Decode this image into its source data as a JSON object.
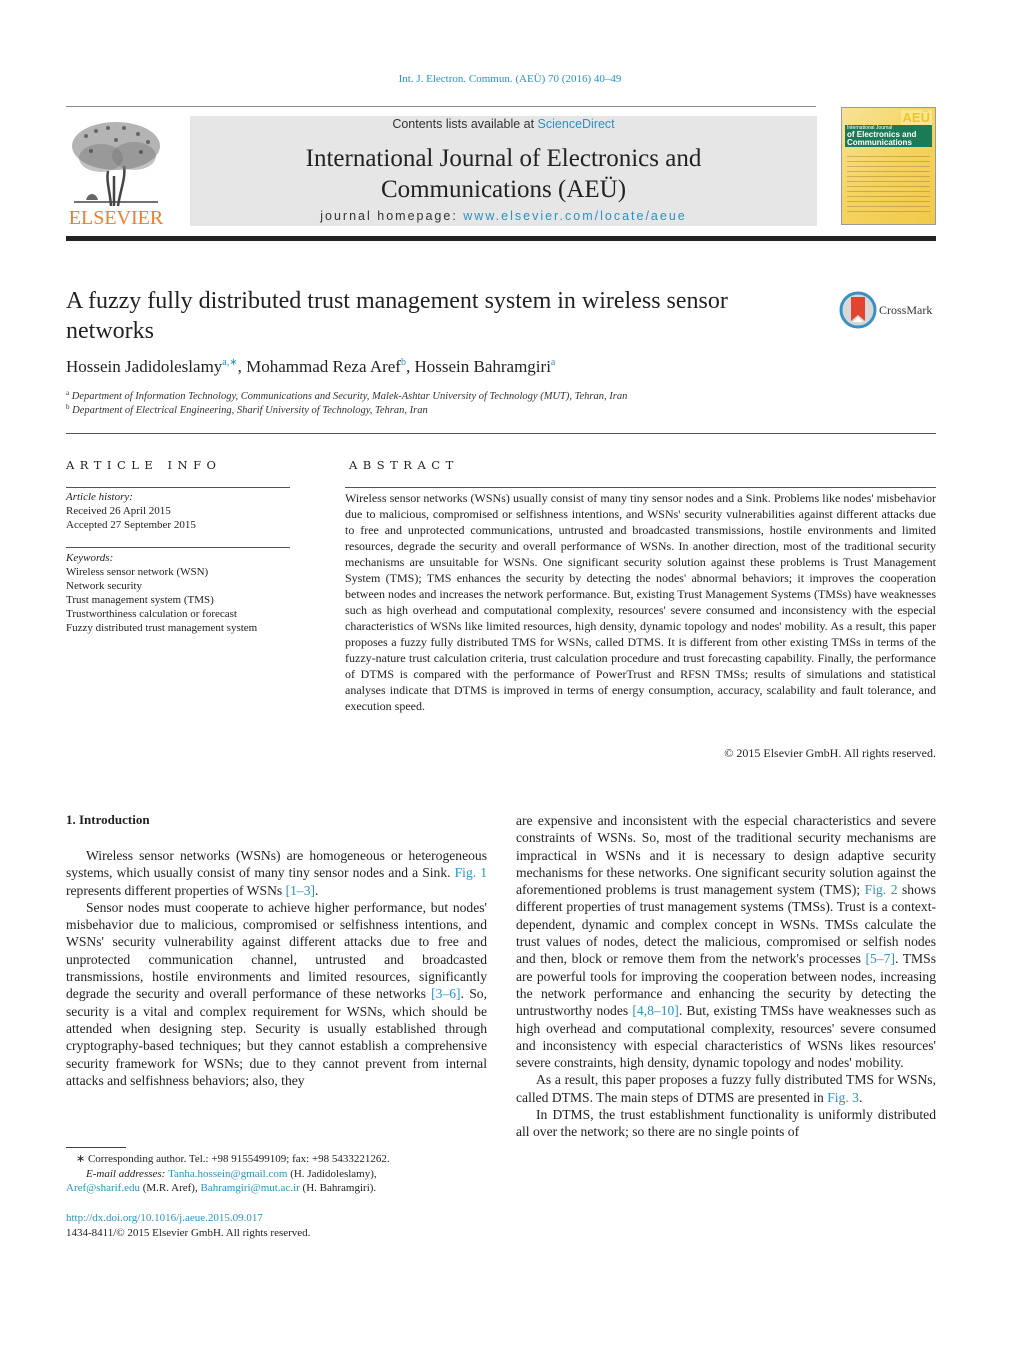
{
  "header": {
    "citation": "Int. J. Electron. Commun. (AEÜ) 70 (2016) 40–49",
    "publisher_logo_text": "ELSEVIER",
    "contents_prefix": "Contents lists available at ",
    "contents_link": "ScienceDirect",
    "journal_title_line1": "International Journal of Electronics and",
    "journal_title_line2": "Communications (AEÜ)",
    "homepage_prefix": "journal homepage: ",
    "homepage_link": "www.elsevier.com/locate/aeue",
    "cover": {
      "badge": "AEÜ",
      "line1": "International Journal",
      "line2": "of Electronics and",
      "line3": "Communications"
    }
  },
  "article": {
    "title": "A fuzzy fully distributed trust management system in wireless sensor networks",
    "crossmark_label": "CrossMark",
    "authors": [
      {
        "name": "Hossein Jadidoleslamy",
        "sup": "a,∗"
      },
      {
        "name": "Mohammad Reza Aref",
        "sup": "b"
      },
      {
        "name": "Hossein Bahramgiri",
        "sup": "a"
      }
    ],
    "affiliations": [
      {
        "mark": "a",
        "text": "Department of Information Technology, Communications and Security, Malek-Ashtar University of Technology (MUT), Tehran, Iran"
      },
      {
        "mark": "b",
        "text": "Department of Electrical Engineering, Sharif University of Technology, Tehran, Iran"
      }
    ]
  },
  "article_info": {
    "heading": "ARTICLE INFO",
    "history_label": "Article history:",
    "received": "Received 26 April 2015",
    "accepted": "Accepted 27 September 2015",
    "keywords_label": "Keywords:",
    "keywords": [
      "Wireless sensor network (WSN)",
      "Network security",
      "Trust management system (TMS)",
      "Trustworthiness calculation or forecast",
      "Fuzzy distributed trust management system"
    ]
  },
  "abstract": {
    "heading": "ABSTRACT",
    "text": "Wireless sensor networks (WSNs) usually consist of many tiny sensor nodes and a Sink. Problems like nodes' misbehavior due to malicious, compromised or selfishness intentions, and WSNs' security vulnerabilities against different attacks due to free and unprotected communications, untrusted and broadcasted transmissions, hostile environments and limited resources, degrade the security and overall performance of WSNs. In another direction, most of the traditional security mechanisms are unsuitable for WSNs. One significant security solution against these problems is Trust Management System (TMS); TMS enhances the security by detecting the nodes' abnormal behaviors; it improves the cooperation between nodes and increases the network performance. But, existing Trust Management Systems (TMSs) have weaknesses such as high overhead and computational complexity, resources' severe consumed and inconsistency with the especial characteristics of WSNs like limited resources, high density, dynamic topology and nodes' mobility. As a result, this paper proposes a fuzzy fully distributed TMS for WSNs, called DTMS. It is different from other existing TMSs in terms of the fuzzy-nature trust calculation criteria, trust calculation procedure and trust forecasting capability. Finally, the performance of DTMS is compared with the performance of PowerTrust and RFSN TMSs; results of simulations and statistical analyses indicate that DTMS is improved in terms of energy consumption, accuracy, scalability and fault tolerance, and execution speed.",
    "copyright": "© 2015 Elsevier GmbH. All rights reserved."
  },
  "body": {
    "section_heading": "1.  Introduction",
    "left": {
      "p1_a": "Wireless sensor networks (WSNs) are homogeneous or heterogeneous systems, which usually consist of many tiny sensor nodes and a Sink. ",
      "p1_ref_fig": "Fig. 1",
      "p1_b": " represents different properties of WSNs ",
      "p1_ref": "[1–3]",
      "p1_c": ".",
      "p2_a": "Sensor nodes must cooperate to achieve higher performance, but nodes' misbehavior due to malicious, compromised or selfishness intentions, and WSNs' security vulnerability against different attacks due to free and unprotected communication channel, untrusted and broadcasted transmissions, hostile environments and limited resources, significantly degrade the security and overall performance of these networks ",
      "p2_ref": "[3–6]",
      "p2_b": ". So, security is a vital and complex requirement for WSNs, which should be attended when designing step. Security is usually established through cryptography-based techniques; but they cannot establish a comprehensive security framework for WSNs; due to they cannot prevent from internal attacks and selfishness behaviors; also, they"
    },
    "right": {
      "p1_a": "are expensive and inconsistent with the especial characteristics and severe constraints of WSNs. So, most of the traditional security mechanisms are impractical in WSNs and it is necessary to design adaptive security mechanisms for these networks. One significant security solution against the aforementioned problems is trust management system (TMS); ",
      "p1_ref_fig": "Fig. 2",
      "p1_b": " shows different properties of trust management systems (TMSs). Trust is a context-dependent, dynamic and complex concept in WSNs. TMSs calculate the trust values of nodes, detect the malicious, compromised or selfish nodes and then, block or remove them from the network's processes ",
      "p1_ref1": "[5–7]",
      "p1_c": ". TMSs are powerful tools for improving the cooperation between nodes, increasing the network performance and enhancing the security by detecting the untrustworthy nodes ",
      "p1_ref2": "[4,8–10]",
      "p1_d": ". But, existing TMSs have weaknesses such as high overhead and computational complexity, resources' severe consumed and inconsistency with especial characteristics of WSNs likes resources' severe constraints, high density, dynamic topology and nodes' mobility.",
      "p2_a": "As a result, this paper proposes a fuzzy fully distributed TMS for WSNs, called DTMS. The main steps of DTMS are presented in ",
      "p2_ref_fig": "Fig. 3",
      "p2_b": ".",
      "p3": "In DTMS, the trust establishment functionality is uniformly distributed all over the network; so there are no single points of"
    }
  },
  "footnotes": {
    "corresponding": "∗  Corresponding author. Tel.: +98 9155499109; fax: +98 5433221262.",
    "email_label": "E-mail addresses: ",
    "email1": "Tanha.hossein@gmail.com",
    "email1_owner": " (H. Jadidoleslamy),",
    "email2": "Aref@sharif.edu",
    "email2_owner": " (M.R. Aref), ",
    "email3": "Bahramgiri@mut.ac.ir",
    "email3_owner": " (H. Bahramgiri).",
    "doi_link": "http://dx.doi.org/10.1016/j.aeue.2015.09.017",
    "issn_line": "1434-8411/© 2015 Elsevier GmbH. All rights reserved."
  }
}
